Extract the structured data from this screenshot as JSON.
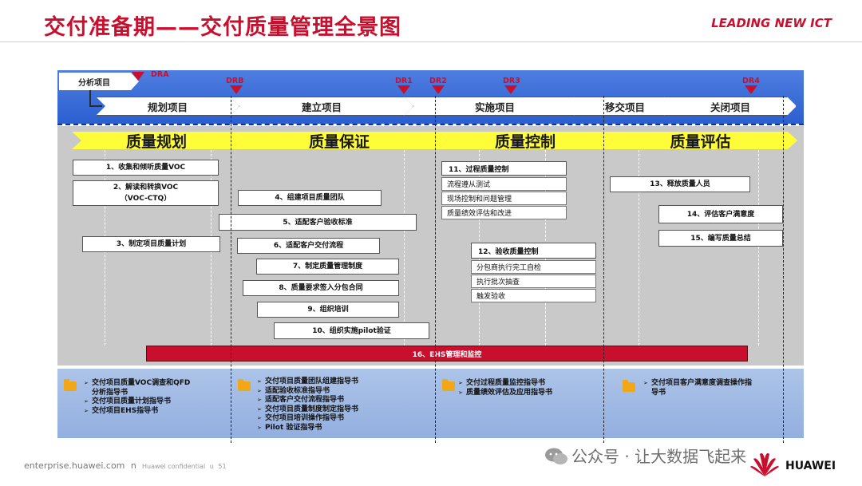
{
  "title": "交付准备期——交付质量管理全景图",
  "brand": "LEADING NEW ICT",
  "phases": {
    "analysis": "分析项目",
    "items": [
      "规划项目",
      "建立项目",
      "实施项目",
      "移交项目",
      "关闭项目"
    ]
  },
  "markers": [
    "DRA",
    "DRB",
    "DR1",
    "DR2",
    "DR3",
    "DR4"
  ],
  "quality_areas": [
    "质量规划",
    "质量保证",
    "质量控制",
    "质量评估"
  ],
  "planning_items": {
    "item1": "1、收集和倾听质量VOC",
    "item2_line1": "2、解读和转换VOC",
    "item2_line2": "（VOC-CTQ）",
    "item3": "3、制定项目质量计划"
  },
  "assurance_items": [
    "4、组建项目质量团队",
    "5、适配客户验收标准",
    "6、适配客户交付流程",
    "7、制定质量管理制度",
    "8、质量要求签入分包合同",
    "9、组织培训",
    "10、组织实施pilot验证"
  ],
  "control": {
    "process_title": "11、过程质量控制",
    "process_rows": [
      "流程遵从测试",
      "现场控制和问题管理",
      "质量绩效评估和改进"
    ],
    "acceptance_title": "12、验收质量控制",
    "acceptance_rows": [
      "分包商执行完工自检",
      "执行批次抽查",
      "触发验收"
    ]
  },
  "evaluation_items": [
    "13、释放质量人员",
    "14、评估客户满意度",
    "15、编写质量总结"
  ],
  "ehs": "16、EHS管理和监控",
  "guides": {
    "planning": [
      "交付项目质量VOC调查和QFD分析指导书",
      "交付项目质量计划指导书",
      "交付项目EHS指导书"
    ],
    "assurance": [
      "交付项目质量团队组建指导书",
      "适配验收标准指导书",
      "适配客户交付流程指导书",
      "交付项目质量制度制定指导书",
      "交付项目培训操作指导书",
      "Pilot 验证指导书"
    ],
    "control": [
      "交付过程质量监控指导书",
      "质量绩效评估及应用指导书"
    ],
    "evaluation": [
      "交付项目客户满意度调查操作指导书"
    ]
  },
  "footer": {
    "site": "enterprise.huawei.com",
    "site_suffix": "n",
    "confidential": "Huawei confidential",
    "conf_mark": "u",
    "page": "51",
    "watermark": "公众号 · 让大数据飞起来",
    "logo_text": "HUAWEI"
  },
  "colors": {
    "title_red": "#c8102e",
    "phase_blue": "#2b5fd0",
    "quality_yellow": "#fffc3a",
    "ehs_red": "#c8102e",
    "guide_blue": "#a5bde6",
    "panel_grey": "#c9c9c9"
  },
  "icons": [
    "folder-icon",
    "wechat-icon",
    "huawei-logo-icon"
  ]
}
